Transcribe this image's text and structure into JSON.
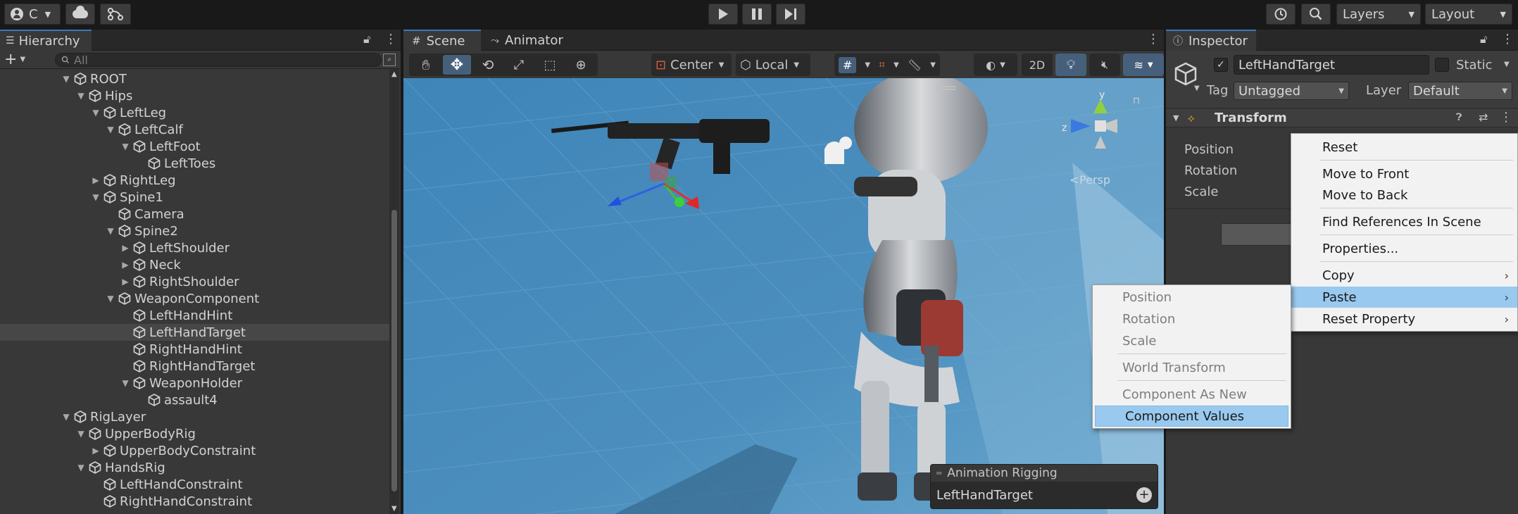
{
  "topbar": {
    "account_label": "C",
    "layers_label": "Layers",
    "layout_label": "Layout"
  },
  "hierarchy": {
    "title": "Hierarchy",
    "search_placeholder": "All",
    "items": [
      {
        "label": "ROOT",
        "depth": 0,
        "fold": "open"
      },
      {
        "label": "Hips",
        "depth": 1,
        "fold": "open"
      },
      {
        "label": "LeftLeg",
        "depth": 2,
        "fold": "open"
      },
      {
        "label": "LeftCalf",
        "depth": 3,
        "fold": "open"
      },
      {
        "label": "LeftFoot",
        "depth": 4,
        "fold": "open"
      },
      {
        "label": "LeftToes",
        "depth": 5,
        "fold": "none"
      },
      {
        "label": "RightLeg",
        "depth": 2,
        "fold": "closed"
      },
      {
        "label": "Spine1",
        "depth": 2,
        "fold": "open"
      },
      {
        "label": "Camera",
        "depth": 3,
        "fold": "none"
      },
      {
        "label": "Spine2",
        "depth": 3,
        "fold": "open"
      },
      {
        "label": "LeftShoulder",
        "depth": 4,
        "fold": "closed"
      },
      {
        "label": "Neck",
        "depth": 4,
        "fold": "closed"
      },
      {
        "label": "RightShoulder",
        "depth": 4,
        "fold": "closed"
      },
      {
        "label": "WeaponComponent",
        "depth": 3,
        "fold": "open"
      },
      {
        "label": "LeftHandHint",
        "depth": 4,
        "fold": "none"
      },
      {
        "label": "LeftHandTarget",
        "depth": 4,
        "fold": "none",
        "selected": true
      },
      {
        "label": "RightHandHint",
        "depth": 4,
        "fold": "none"
      },
      {
        "label": "RightHandTarget",
        "depth": 4,
        "fold": "none"
      },
      {
        "label": "WeaponHolder",
        "depth": 4,
        "fold": "open"
      },
      {
        "label": "assault4",
        "depth": 5,
        "fold": "none"
      },
      {
        "label": "RigLayer",
        "depth": 0,
        "fold": "open"
      },
      {
        "label": "UpperBodyRig",
        "depth": 1,
        "fold": "open"
      },
      {
        "label": "UpperBodyConstraint",
        "depth": 2,
        "fold": "closed"
      },
      {
        "label": "HandsRig",
        "depth": 1,
        "fold": "open"
      },
      {
        "label": "LeftHandConstraint",
        "depth": 2,
        "fold": "none"
      },
      {
        "label": "RightHandConstraint",
        "depth": 2,
        "fold": "none"
      }
    ]
  },
  "scene": {
    "tab_scene": "Scene",
    "tab_animator": "Animator",
    "pivot_label": "Center",
    "space_label": "Local",
    "mode_2d": "2D",
    "gizmo_y": "y",
    "gizmo_z": "z",
    "persp_label": "Persp",
    "overlay_title": "Animation Rigging",
    "overlay_value": "LeftHandTarget"
  },
  "inspector": {
    "title": "Inspector",
    "object_name": "LeftHandTarget",
    "static_label": "Static",
    "tag_label": "Tag",
    "tag_value": "Untagged",
    "layer_label": "Layer",
    "layer_value": "Default",
    "component_title": "Transform",
    "position_label": "Position",
    "rotation_label": "Rotation",
    "scale_label": "Scale"
  },
  "context_menu": {
    "items": [
      "Reset",
      "Move to Front",
      "Move to Back",
      "Find References In Scene",
      "Properties...",
      "Copy",
      "Paste",
      "Reset Property"
    ]
  },
  "paste_submenu": {
    "items": [
      "Position",
      "Rotation",
      "Scale",
      "World Transform",
      "Component As New",
      "Component Values"
    ]
  },
  "colors": {
    "accent": "#3a79bb",
    "menu_highlight": "#99c9ef",
    "scene_sky": "#4a8ab8"
  }
}
